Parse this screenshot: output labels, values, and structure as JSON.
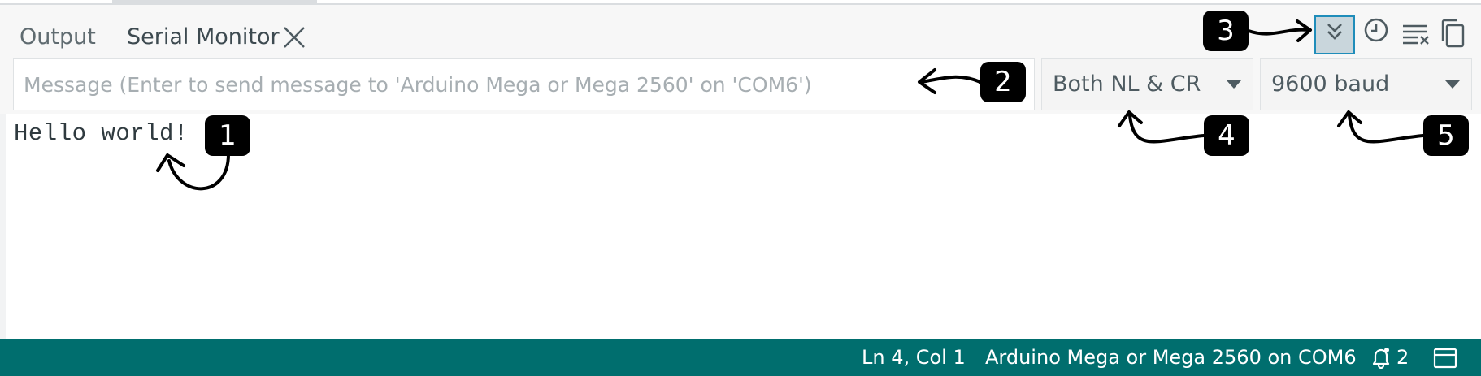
{
  "tabs": [
    {
      "label": "Output",
      "active": false
    },
    {
      "label": "Serial Monitor",
      "active": true
    }
  ],
  "toolbar": {
    "autoscroll_icon": "double-chevron-down-icon",
    "timestamp_icon": "clock-icon",
    "clear_icon": "clear-output-icon",
    "copy_icon": "copy-icon"
  },
  "message": {
    "placeholder": "Message (Enter to send message to 'Arduino Mega or Mega 2560' on 'COM6')",
    "value": ""
  },
  "line_ending": {
    "selected": "Both NL & CR"
  },
  "baud_rate": {
    "selected": "9600 baud"
  },
  "console": {
    "lines": [
      "Hello world!"
    ]
  },
  "status_bar": {
    "position": "Ln 4, Col 1",
    "board": "Arduino Mega or Mega 2560 on COM6",
    "notifications": "2"
  },
  "annotations": [
    {
      "label": "1"
    },
    {
      "label": "2"
    },
    {
      "label": "3"
    },
    {
      "label": "4"
    },
    {
      "label": "5"
    }
  ],
  "colors": {
    "status_bar": "#006e6e",
    "autoscroll_active_bg": "#c9d6dc",
    "autoscroll_active_border": "#1f8dba",
    "badge": "#000000"
  }
}
